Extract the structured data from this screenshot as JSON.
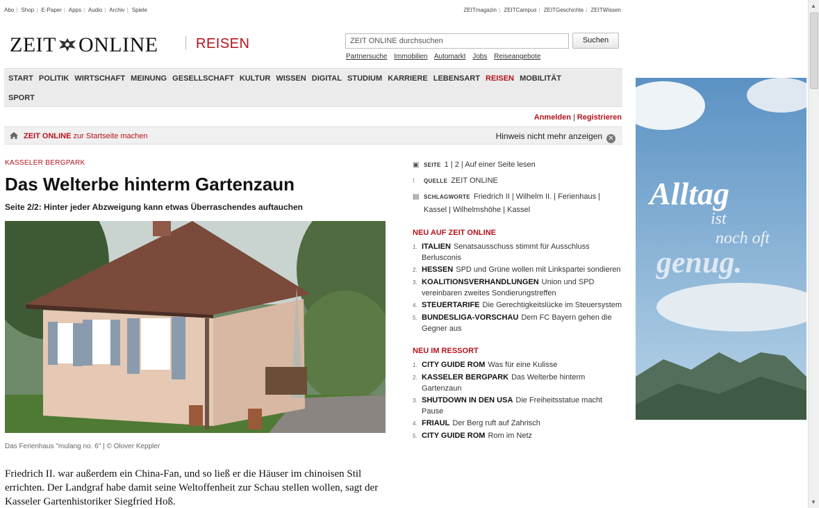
{
  "topbar": {
    "left_links": [
      "Abo",
      "Shop",
      "E-Paper",
      "Apps",
      "Audio",
      "Archiv",
      "Spiele"
    ],
    "right_links": [
      "ZEITmagazin",
      "ZEITCampus",
      "ZEITGeschichte",
      "ZEITWissen"
    ]
  },
  "header": {
    "logo_left": "ZEIT",
    "logo_right": "ONLINE",
    "section": "REISEN",
    "search_placeholder": "ZEIT ONLINE durchsuchen",
    "search_button": "Suchen",
    "quicklinks": [
      "Partnersuche",
      "Immobilien",
      "Automarkt",
      "Jobs",
      "Reiseangebote"
    ]
  },
  "nav": {
    "row1": [
      "START",
      "POLITIK",
      "WIRTSCHAFT",
      "MEINUNG",
      "GESELLSCHAFT",
      "KULTUR",
      "WISSEN",
      "DIGITAL",
      "STUDIUM",
      "KARRIERE",
      "LEBENSART",
      "REISEN",
      "MOBILITÄT"
    ],
    "row2": [
      "SPORT"
    ],
    "active": "REISEN"
  },
  "account": {
    "login": "Anmelden",
    "register": "Registrieren"
  },
  "startpage": {
    "brand": "ZEIT ONLINE",
    "text": "zur Startseite machen",
    "dismiss": "Hinweis nicht mehr anzeigen"
  },
  "article": {
    "kicker": "KASSELER BERGPARK",
    "headline": "Das Welterbe hinterm Gartenzaun",
    "subline": "Seite 2/2: Hinter jeder Abzweigung kann etwas Überraschendes auftauchen",
    "caption": "Das Ferienhaus \"mulang no. 6\"  |  © Olover Keppler",
    "body": "Friedrich II. war außerdem ein China-Fan, und so ließ er die Häuser im chinoisen Stil errichten. Der Landgraf habe damit seine Weltoffenheit zur Schau stellen wollen, sagt der Kasseler Gartenhistoriker Siegfried Hoß."
  },
  "meta": {
    "seite_label": "SEITE",
    "seite_1": "1",
    "seite_2": "2",
    "seite_all": "Auf einer Seite lesen",
    "quelle_label": "QUELLE",
    "quelle": "ZEIT ONLINE",
    "tags_label": "SCHLAGWORTE",
    "tags": "Friedrich II | Wilhelm II. | Ferienhaus | Kassel | Wilhelmshöhe | Kassel"
  },
  "neu_auf": {
    "title": "NEU AUF ZEIT ONLINE",
    "items": [
      {
        "num": "1.",
        "label": "ITALIEN",
        "text": "Senatsausschuss stimmt für Ausschluss Berlusconis"
      },
      {
        "num": "2.",
        "label": "HESSEN",
        "text": "SPD und Grüne wollen mit Linkspartei sondieren"
      },
      {
        "num": "3.",
        "label": "KOALITIONSVERHANDLUNGEN",
        "text": "Union und SPD vereinbaren zweites Sondierungstreffen"
      },
      {
        "num": "4.",
        "label": "STEUERTARIFE",
        "text": "Die Gerechtigkeitslücke im Steuersystem"
      },
      {
        "num": "5.",
        "label": "BUNDESLIGA-VORSCHAU",
        "text": "Dem FC Bayern gehen die Gegner aus"
      }
    ]
  },
  "neu_im": {
    "title": "NEU IM RESSORT",
    "items": [
      {
        "num": "1.",
        "label": "CITY GUIDE ROM",
        "text": "Was für eine Kulisse"
      },
      {
        "num": "2.",
        "label": "KASSELER BERGPARK",
        "text": "Das Welterbe hinterm Gartenzaun"
      },
      {
        "num": "3.",
        "label": "SHUTDOWN IN DEN USA",
        "text": "Die Freiheitsstatue macht Pause"
      },
      {
        "num": "4.",
        "label": "FRIAUL",
        "text": "Der Berg ruft auf Zahrisch"
      },
      {
        "num": "5.",
        "label": "CITY GUIDE ROM",
        "text": "Rom im Netz"
      }
    ]
  },
  "ad": {
    "word1": "Alltag",
    "word2": "ist",
    "word3": "noch oft",
    "word4": "genug."
  },
  "colors": {
    "accent": "#b5121b",
    "nav_bg": "#ebebeb"
  },
  "icons": {
    "home": "home-icon",
    "close": "close-circle-icon",
    "page": "page-icon",
    "source": "source-icon",
    "tags": "tags-icon"
  }
}
